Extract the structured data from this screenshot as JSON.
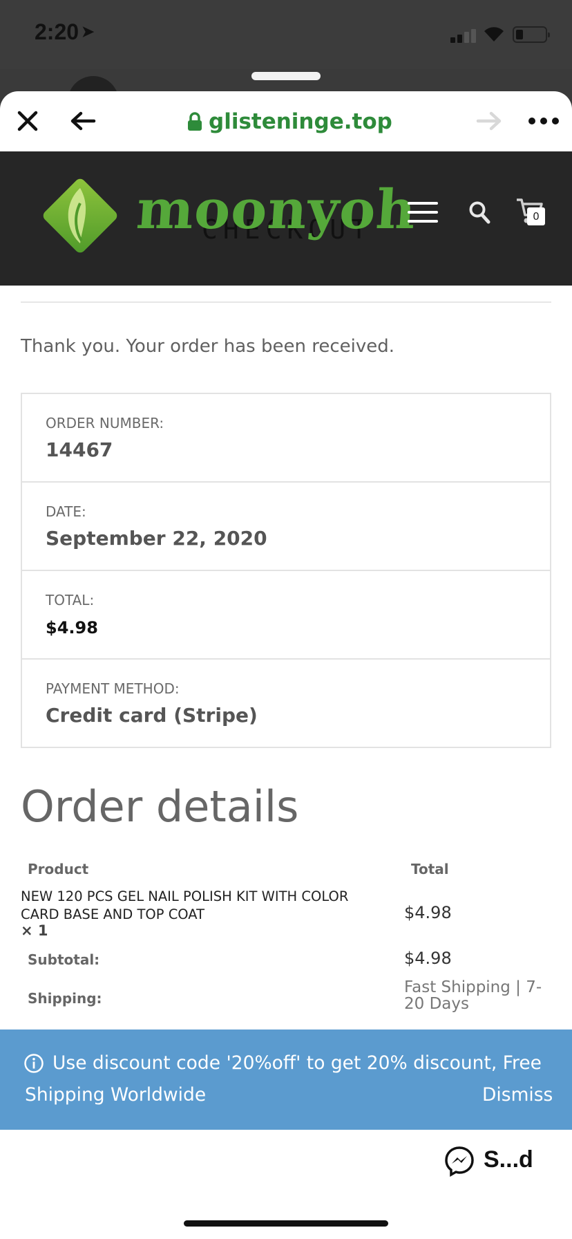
{
  "status_bar": {
    "time": "2:20"
  },
  "browser": {
    "url": "glisteninge.top"
  },
  "site": {
    "logo_text": "moonyoh",
    "page_banner": "CHECKOUT",
    "cart_count": "0"
  },
  "order": {
    "thank_you": "Thank you. Your order has been received.",
    "overview": [
      {
        "label": "ORDER NUMBER:",
        "value": "14467"
      },
      {
        "label": "DATE:",
        "value": "September 22, 2020"
      },
      {
        "label": "TOTAL:",
        "value": "$4.98"
      },
      {
        "label": "PAYMENT METHOD:",
        "value": "Credit card (Stripe)"
      }
    ],
    "details_title": "Order details",
    "table_headers": {
      "product": "Product",
      "total": "Total"
    },
    "item": {
      "name": "NEW 120 PCS GEL NAIL POLISH KIT WITH COLOR CARD BASE AND TOP COAT",
      "qty": "× 1",
      "total": "$4.98"
    },
    "subtotal_label": "Subtotal:",
    "subtotal_value": "$4.98",
    "shipping_label": "Shipping:",
    "shipping_value": "Fast Shipping | 7-20 Days"
  },
  "notice": {
    "line1": "Use discount code '20%off' to get 20% discount, Free",
    "line2": "Shipping Worldwide",
    "dismiss": "Dismiss"
  },
  "messenger": {
    "label": "S...d"
  },
  "colors": {
    "url_green": "#2e8b3a",
    "logo_green": "#55a83a",
    "header_bg": "#262626",
    "notice_bg": "#5b9bcf"
  }
}
